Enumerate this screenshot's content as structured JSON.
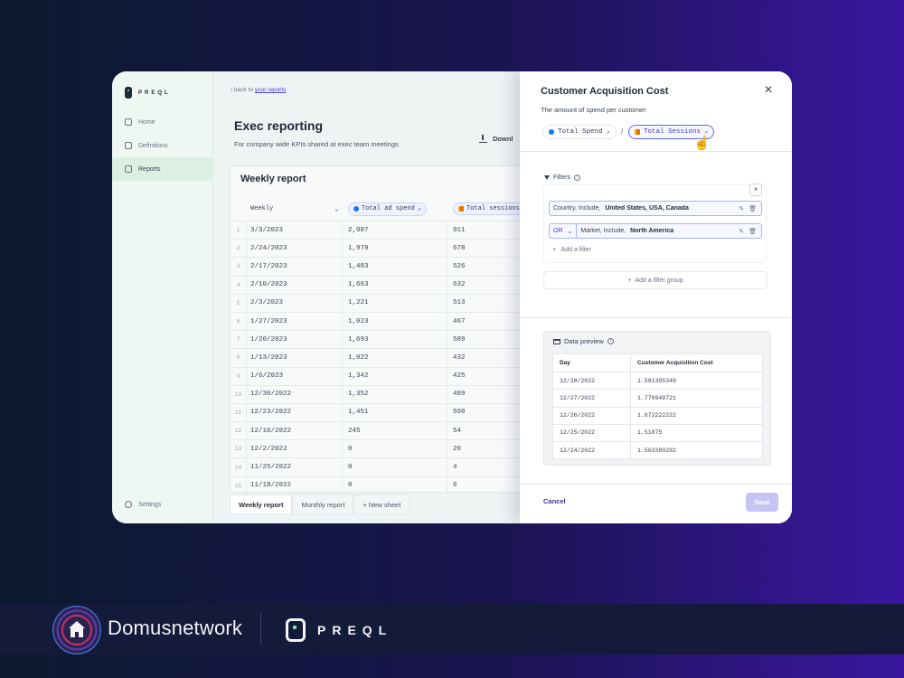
{
  "sidebar": {
    "logo": "PREQL",
    "items": [
      {
        "label": "Home"
      },
      {
        "label": "Definitions"
      },
      {
        "label": "Reports"
      }
    ],
    "settings": "Settings"
  },
  "main": {
    "back_prefix": "back to",
    "back_link": "your reports",
    "title": "Exec reporting",
    "subtitle": "For company wide KPIs shared at exec team meetings",
    "download": "Downl",
    "report_title": "Weekly report",
    "columns": [
      "Weekly",
      "Total ad spend",
      "Total sessions"
    ],
    "rows": [
      {
        "n": "1",
        "date": "3/3/2023",
        "spend": "2,087",
        "sessions": "911"
      },
      {
        "n": "2",
        "date": "2/24/2023",
        "spend": "1,979",
        "sessions": "678"
      },
      {
        "n": "3",
        "date": "2/17/2023",
        "spend": "1,483",
        "sessions": "526"
      },
      {
        "n": "4",
        "date": "2/10/2023",
        "spend": "1,663",
        "sessions": "632"
      },
      {
        "n": "5",
        "date": "2/3/2023",
        "spend": "1,221",
        "sessions": "513"
      },
      {
        "n": "6",
        "date": "1/27/2023",
        "spend": "1,023",
        "sessions": "467"
      },
      {
        "n": "7",
        "date": "1/20/2023",
        "spend": "1,693",
        "sessions": "589"
      },
      {
        "n": "8",
        "date": "1/13/2023",
        "spend": "1,022",
        "sessions": "432"
      },
      {
        "n": "9",
        "date": "1/6/2023",
        "spend": "1,342",
        "sessions": "425"
      },
      {
        "n": "10",
        "date": "12/30/2022",
        "spend": "1,352",
        "sessions": "489"
      },
      {
        "n": "11",
        "date": "12/23/2022",
        "spend": "1,451",
        "sessions": "560"
      },
      {
        "n": "12",
        "date": "12/16/2022",
        "spend": "245",
        "sessions": "54"
      },
      {
        "n": "13",
        "date": "12/2/2022",
        "spend": "0",
        "sessions": "20"
      },
      {
        "n": "14",
        "date": "11/25/2022",
        "spend": "0",
        "sessions": "4"
      },
      {
        "n": "15",
        "date": "11/18/2022",
        "spend": "0",
        "sessions": "6"
      }
    ],
    "tabs": [
      "Weekly report",
      "Monthly report",
      "New sheet"
    ]
  },
  "modal": {
    "title": "Customer Acquisition Cost",
    "subtitle": "The amount of spend per customer",
    "chip_spend": "Total Spend",
    "chip_sessions": "Total Sessions",
    "slash": "/",
    "filters_label": "Filters",
    "filter1_prefix": "Country, Include,",
    "filter1_value": "United States, USA, Canada",
    "filter2_op": "OR",
    "filter2_prefix": "Market, Include,",
    "filter2_value": "North America",
    "add_filter": "Add a filter",
    "add_group": "Add a filter group",
    "preview_label": "Data preview",
    "preview_headers": [
      "Day",
      "Customer Acquisition Cost"
    ],
    "preview_rows": [
      [
        "12/28/2022",
        "1.581395349"
      ],
      [
        "12/27/2022",
        "1.770949721"
      ],
      [
        "12/26/2022",
        "1.672222222"
      ],
      [
        "12/25/2022",
        "1.51875"
      ],
      [
        "12/24/2022",
        "1.563380282"
      ]
    ],
    "cancel": "Cancel",
    "save": "Save"
  },
  "brand": {
    "domus": "Domusnetwork",
    "preql": "PREQL"
  }
}
